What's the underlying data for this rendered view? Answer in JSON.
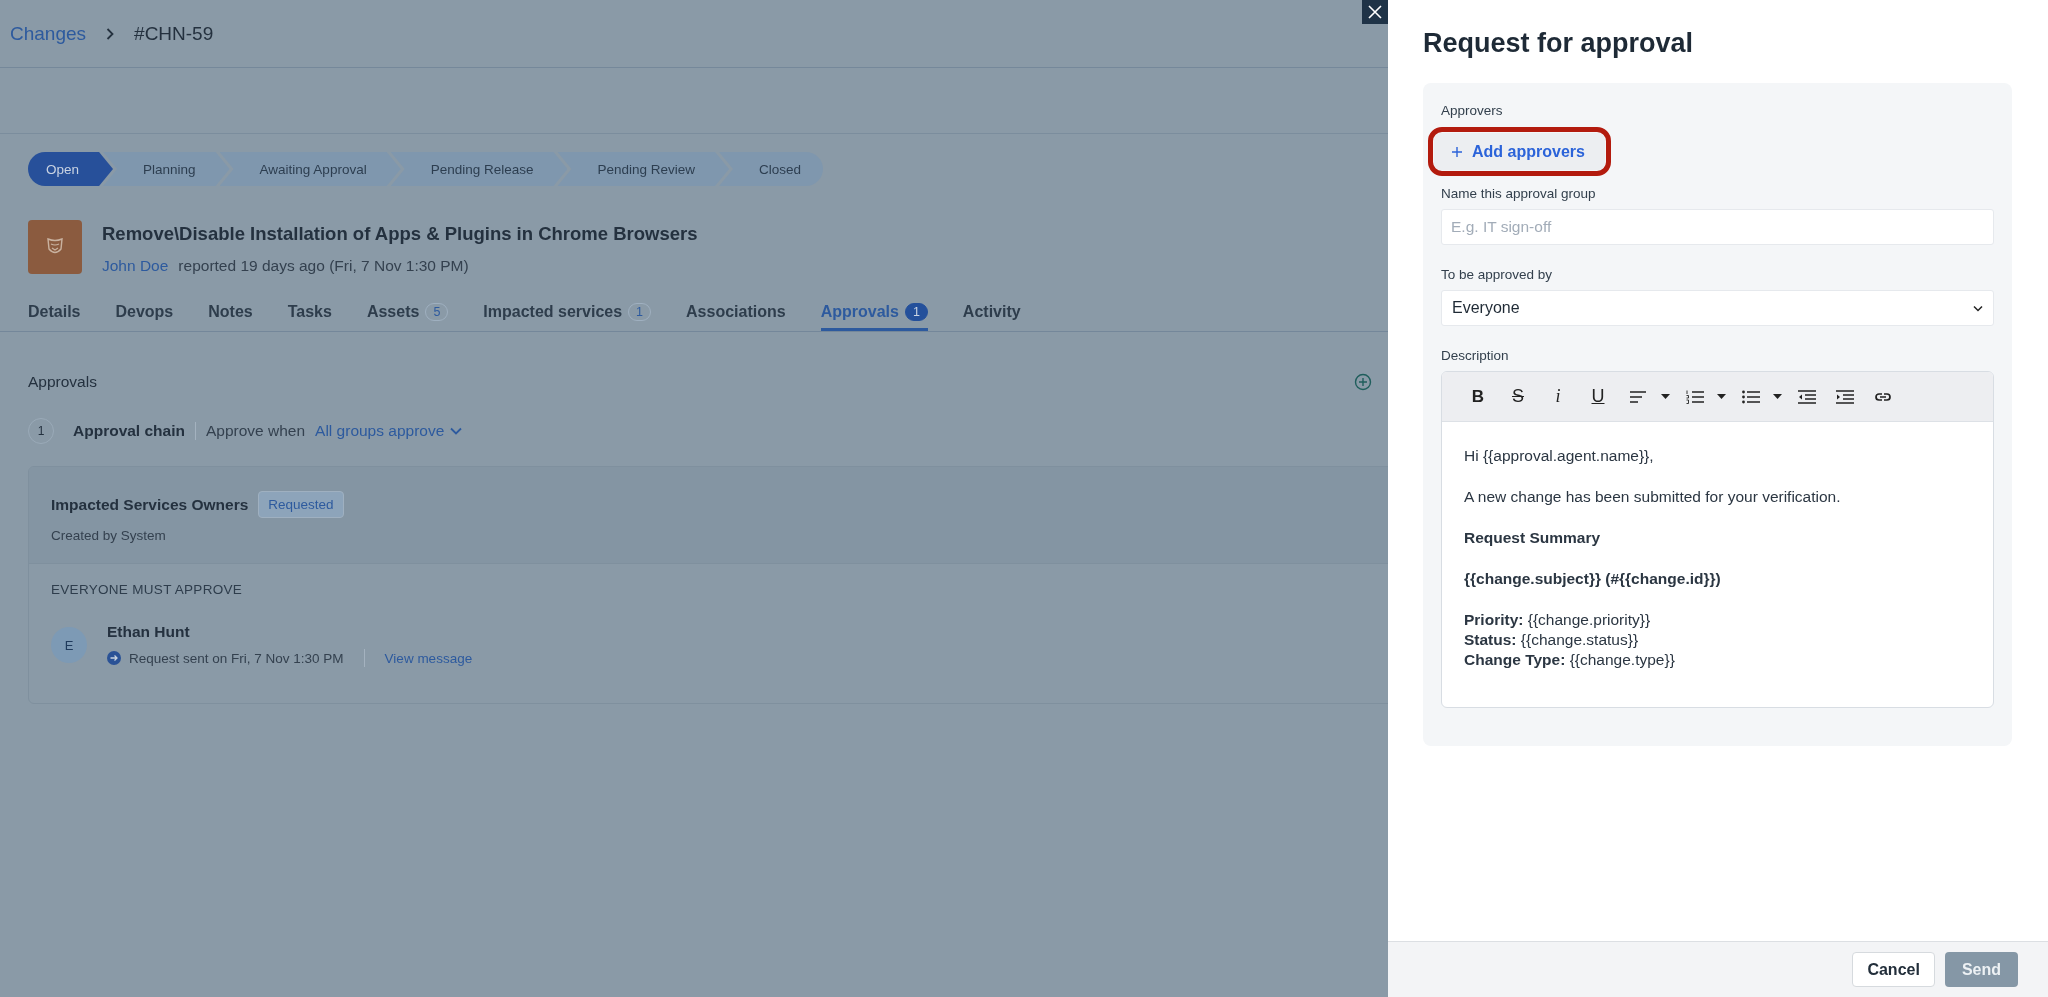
{
  "breadcrumb": {
    "parent": "Changes",
    "current": "#CHN-59"
  },
  "stages": [
    {
      "label": "Open",
      "selected": true
    },
    {
      "label": "Planning",
      "selected": false
    },
    {
      "label": "Awaiting Approval",
      "selected": false
    },
    {
      "label": "Pending Release",
      "selected": false
    },
    {
      "label": "Pending Review",
      "selected": false
    },
    {
      "label": "Closed",
      "selected": false
    }
  ],
  "ticket": {
    "title": "Remove\\Disable Installation of Apps & Plugins in Chrome Browsers",
    "reporter": "John Doe",
    "reported": "reported 19 days ago (Fri, 7 Nov 1:30 PM)"
  },
  "tabs": [
    {
      "label": "Details",
      "selected": false
    },
    {
      "label": "Devops",
      "selected": false
    },
    {
      "label": "Notes",
      "selected": false
    },
    {
      "label": "Tasks",
      "selected": false
    },
    {
      "label": "Assets",
      "count": "5",
      "selected": false
    },
    {
      "label": "Impacted services",
      "count": "1",
      "selected": false
    },
    {
      "label": "Associations",
      "selected": false
    },
    {
      "label": "Approvals",
      "count": "1",
      "selected": true
    },
    {
      "label": "Activity",
      "selected": false
    }
  ],
  "approvals": {
    "heading": "Approvals",
    "chain": {
      "number": "1",
      "label": "Approval chain",
      "approve_when": "Approve when",
      "rule": "All groups approve"
    },
    "group": {
      "name": "Impacted Services Owners",
      "status": "Requested",
      "created_by": "Created by System",
      "policy": "EVERYONE MUST APPROVE",
      "approvers": [
        {
          "initial": "E",
          "name": "Ethan Hunt",
          "sent": "Request sent on Fri, 7 Nov 1:30 PM",
          "action": "View message"
        }
      ]
    }
  },
  "panel": {
    "title": "Request for approval",
    "approvers_label": "Approvers",
    "add_button": {
      "label": "Add approvers",
      "highlighted": true
    },
    "name_field": {
      "label": "Name this approval group",
      "placeholder": "E.g. IT sign-off"
    },
    "approved_by": {
      "label": "To be approved by",
      "value": "Everyone"
    },
    "description": {
      "label": "Description",
      "toolbar": [
        {
          "kind": "bold",
          "label": "B"
        },
        {
          "kind": "strike",
          "label": "S"
        },
        {
          "kind": "italic",
          "label": "i"
        },
        {
          "kind": "underline",
          "label": "U"
        },
        {
          "kind": "align",
          "has_menu": true
        },
        {
          "kind": "ordered-list",
          "has_menu": true
        },
        {
          "kind": "bullet-list",
          "has_menu": true
        },
        {
          "kind": "outdent"
        },
        {
          "kind": "indent"
        },
        {
          "kind": "link"
        }
      ],
      "paragraphs": [
        {
          "lines": [
            "Hi {{approval.agent.name}},"
          ],
          "bold": false
        },
        {
          "lines": [
            "A new change has been submitted for your verification."
          ],
          "bold": false
        },
        {
          "lines": [
            "Request Summary"
          ],
          "bold": true
        },
        {
          "lines": [
            "{{change.subject}} (#{{change.id}})"
          ],
          "bold": true
        },
        {
          "lines": [
            "**Priority:** {{change.priority}}",
            "**Status:** {{change.status}}",
            "**Change Type:** {{change.type}}"
          ],
          "bold": false
        }
      ]
    }
  },
  "footer": [
    {
      "label": "Cancel",
      "kind": "secondary",
      "disabled": false
    },
    {
      "label": "Send",
      "kind": "primary",
      "disabled": true
    }
  ]
}
